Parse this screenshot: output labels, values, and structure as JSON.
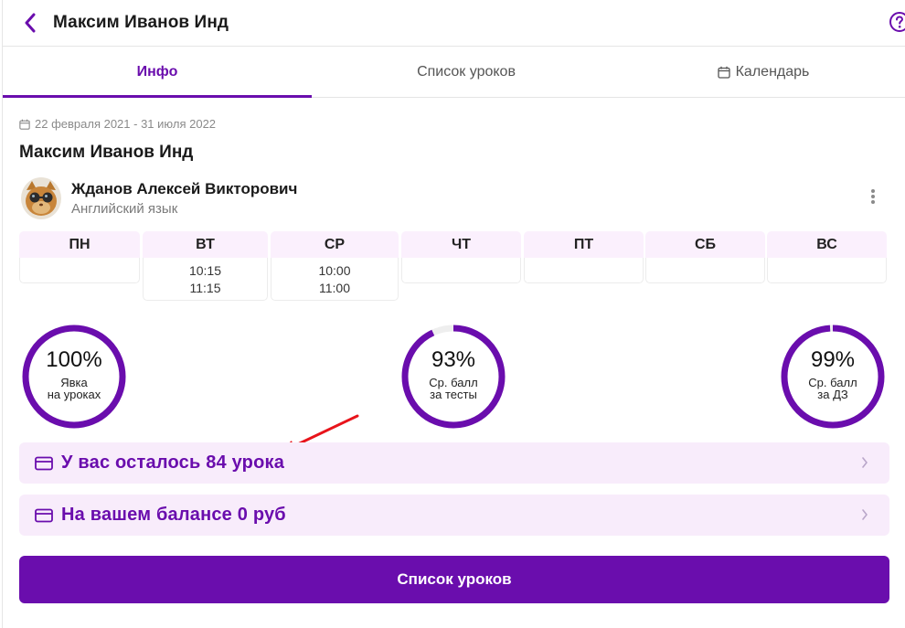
{
  "header": {
    "title": "Максим Иванов Инд"
  },
  "tabs": [
    {
      "label": "Инфо",
      "active": true
    },
    {
      "label": "Список уроков",
      "active": false
    },
    {
      "label": "Календарь",
      "active": false
    }
  ],
  "date_range": "22 февраля 2021 - 31 июля 2022",
  "group_title": "Максим Иванов Инд",
  "teacher": {
    "name": "Жданов Алексей Викторович",
    "subject": "Английский язык"
  },
  "schedule": {
    "days": [
      "ПН",
      "ВТ",
      "СР",
      "ЧТ",
      "ПТ",
      "СБ",
      "ВС"
    ],
    "times": [
      {
        "start": "",
        "end": ""
      },
      {
        "start": "10:15",
        "end": "11:15"
      },
      {
        "start": "10:00",
        "end": "11:00"
      },
      {
        "start": "",
        "end": ""
      },
      {
        "start": "",
        "end": ""
      },
      {
        "start": "",
        "end": ""
      },
      {
        "start": "",
        "end": ""
      }
    ]
  },
  "stats": [
    {
      "value": "100%",
      "percent": 100,
      "line1": "Явка",
      "line2": "на уроках"
    },
    {
      "value": "93%",
      "percent": 93,
      "line1": "Ср. балл",
      "line2": "за тесты"
    },
    {
      "value": "99%",
      "percent": 99,
      "line1": "Ср. балл",
      "line2": "за ДЗ"
    }
  ],
  "info": {
    "lessons_left": "У вас осталось 84 урока",
    "balance": "На вашем балансе 0 руб"
  },
  "primary_button": "Список уроков",
  "colors": {
    "accent": "#6a0dad",
    "light_accent": "#f8ecfb",
    "track": "#eeeeee",
    "annotation_arrow": "#e8141b"
  },
  "icons": {
    "back": "chevron-left-icon",
    "help": "question-circle-icon",
    "calendar": "calendar-icon",
    "more": "more-vertical-icon",
    "card": "credit-card-icon",
    "chevron": "chevron-right-icon"
  }
}
